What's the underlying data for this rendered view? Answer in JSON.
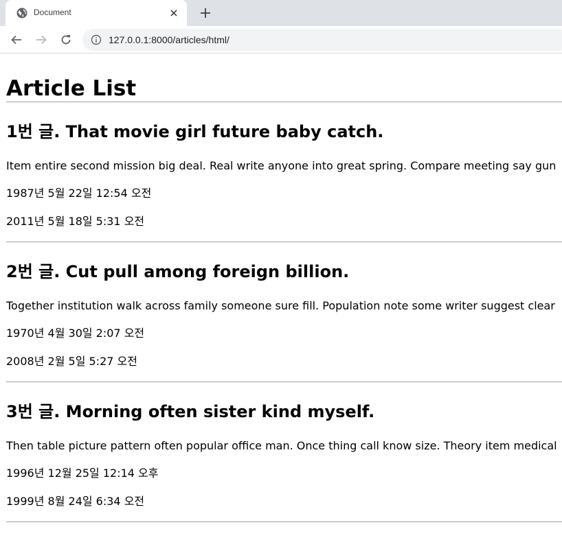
{
  "browser": {
    "tab_title": "Document",
    "url": "127.0.0.1:8000/articles/html/"
  },
  "page": {
    "heading": "Article List",
    "articles": [
      {
        "title": "1번 글. That movie girl future baby catch.",
        "content": "Item entire second mission big deal. Real write anyone into great spring. Compare meeting say gun",
        "created_at": "1987년 5월 22일 12:54 오전",
        "updated_at": "2011년 5월 18일 5:31 오전"
      },
      {
        "title": "2번 글. Cut pull among foreign billion.",
        "content": "Together institution walk across family someone sure fill. Population note some writer suggest clear",
        "created_at": "1970년 4월 30일 2:07 오전",
        "updated_at": "2008년 2월 5일 5:27 오전"
      },
      {
        "title": "3번 글. Morning often sister kind myself.",
        "content": "Then table picture pattern often popular office man. Once thing call know size. Theory item medical",
        "created_at": "1996년 12월 25일 12:14 오후",
        "updated_at": "1999년 8월 24일 6:34 오전"
      }
    ]
  }
}
